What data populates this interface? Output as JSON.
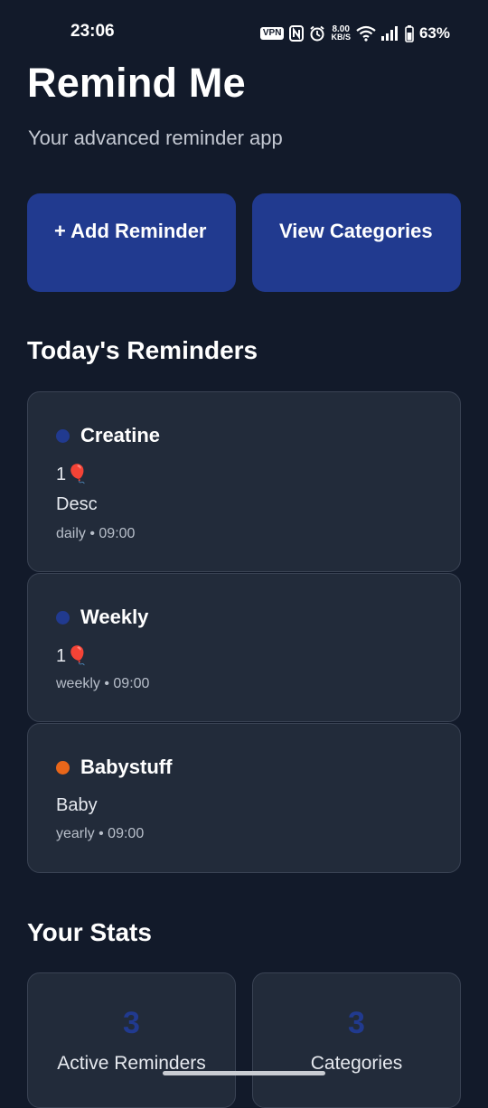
{
  "status_bar": {
    "time": "23:06",
    "vpn": "VPN",
    "speed_value": "8.00",
    "speed_unit": "KB/S",
    "battery": "63%"
  },
  "header": {
    "title": "Remind Me",
    "subtitle": "Your advanced reminder app"
  },
  "actions": {
    "add_label": "+ Add Reminder",
    "view_label": "View Categories"
  },
  "today": {
    "heading": "Today's Reminders",
    "reminders": [
      {
        "title": "Creatine",
        "count": "1🎈",
        "description": "Desc",
        "meta": "daily • 09:00",
        "color": "#213a8f"
      },
      {
        "title": "Weekly",
        "count": "1🎈",
        "meta": "weekly • 09:00",
        "color": "#213a8f"
      },
      {
        "title": "Babystuff",
        "description": "Baby",
        "meta": "yearly • 09:00",
        "color": "#e8661a"
      }
    ]
  },
  "stats": {
    "heading": "Your Stats",
    "items": [
      {
        "value": "3",
        "label": "Active Reminders"
      },
      {
        "value": "3",
        "label": "Categories"
      }
    ]
  },
  "colors": {
    "background": "#121a2a",
    "card": "#222b3a",
    "accent": "#213a8f"
  }
}
